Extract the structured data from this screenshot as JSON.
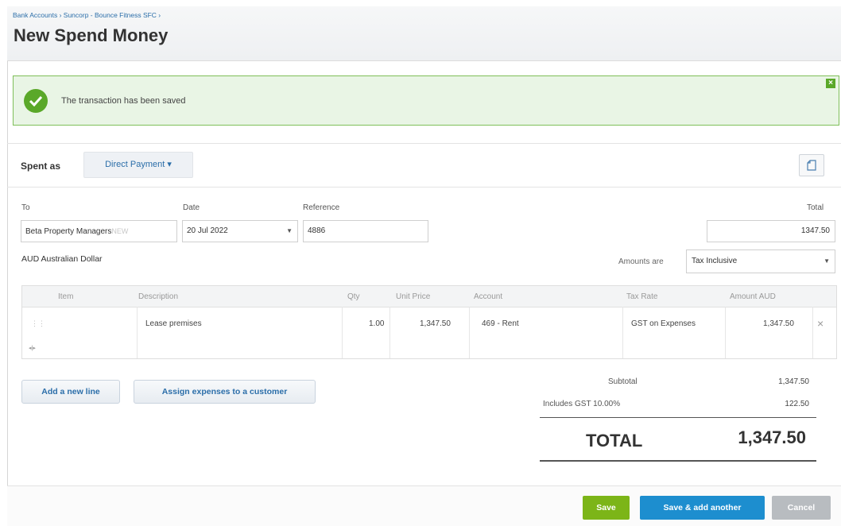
{
  "header": {
    "breadcrumb": "Bank Accounts › Suncorp - Bounce Fitness SFC ›",
    "title": "New Spend Money"
  },
  "notice": {
    "message": "The transaction has been saved",
    "close_icon": "close-icon",
    "status_color": "#5aa829"
  },
  "spent": {
    "label": "Spent as",
    "type": "Direct Payment ▾",
    "doc_icon": "document-icon"
  },
  "form": {
    "to_label": "To",
    "to_value": "Beta Property Managers",
    "to_badge": "NEW",
    "date_label": "Date",
    "date_value": "20 Jul 2022",
    "reference_label": "Reference",
    "reference_value": "4886",
    "total_label": "Total",
    "total_value": "1347.50",
    "currency": "AUD Australian Dollar",
    "amounts_label": "Amounts are",
    "amounts_value": "Tax Inclusive"
  },
  "table": {
    "headers": [
      "Item",
      "Description",
      "Qty",
      "Unit Price",
      "Account",
      "Tax Rate",
      "Amount AUD"
    ],
    "rows": [
      {
        "item": "",
        "description": "Lease premises",
        "qty": "1.00",
        "unit_price": "1,347.50",
        "account": "469 - Rent",
        "tax_rate": "GST on Expenses",
        "amount": "1,347.50"
      }
    ]
  },
  "actions": {
    "add_line": "Add a new line",
    "assign": "Assign expenses to a customer"
  },
  "summary": {
    "subtotal_label": "Subtotal",
    "subtotal_value": "1,347.50",
    "gst_label": "Includes GST 10.00%",
    "gst_value": "122.50",
    "total_label": "TOTAL",
    "total_value": "1,347.50"
  },
  "footer": {
    "save": "Save",
    "save_add": "Save & add another",
    "cancel": "Cancel",
    "save_color": "#7cb518",
    "save_add_color": "#1d8ecf",
    "cancel_color": "#b8bcc0"
  }
}
